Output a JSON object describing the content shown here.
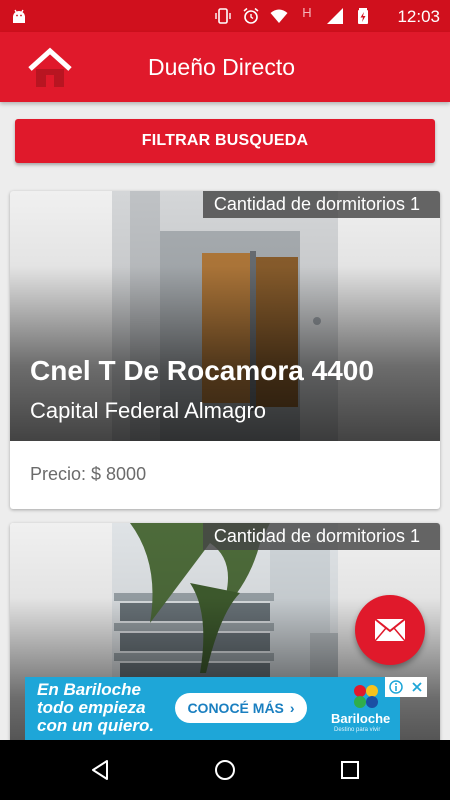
{
  "status_bar": {
    "time": "12:03",
    "icons": [
      "android-debug-icon",
      "vibrate-icon",
      "alarm-icon",
      "wifi-icon",
      "h-network-icon",
      "signal-icon",
      "battery-icon"
    ],
    "network_label": "H"
  },
  "app_bar": {
    "title": "Dueño Directo",
    "logo": "house-logo-icon"
  },
  "filter_button": {
    "label": "FILTRAR BUSQUEDA"
  },
  "listings": [
    {
      "bedrooms_label": "Cantidad de dormitorios 1",
      "address": "Cnel T De Rocamora 4400",
      "location": "Capital Federal Almagro",
      "price": "Precio: $ 8000"
    },
    {
      "bedrooms_label": "Cantidad de dormitorios 1"
    }
  ],
  "fab": {
    "icon": "mail-icon"
  },
  "ad": {
    "text_line1": "En Bariloche",
    "text_line2": "todo empieza",
    "text_line3": "con un quiero.",
    "button_label": "CONOCÉ MÁS",
    "brand": "Bariloche",
    "brand_sub": "Destino para vivir",
    "background": "#1ea6d8"
  },
  "colors": {
    "primary": "#e0192b",
    "status_bar": "#d0101d",
    "background": "#ededed"
  }
}
